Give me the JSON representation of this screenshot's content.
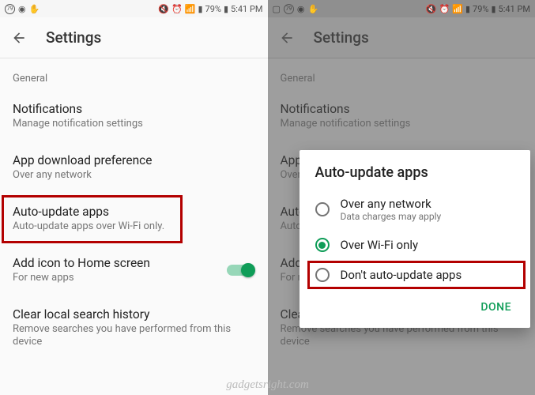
{
  "status": {
    "battery": "79%",
    "time": "5:41 PM",
    "num": "79"
  },
  "appbar": {
    "title": "Settings"
  },
  "section": {
    "general": "General"
  },
  "items": {
    "notifications": {
      "title": "Notifications",
      "sub": "Manage notification settings"
    },
    "download": {
      "title": "App download preference",
      "sub": "Over any network"
    },
    "autoupdate": {
      "title": "Auto-update apps",
      "sub": "Auto-update apps over Wi-Fi only."
    },
    "addicon": {
      "title": "Add icon to Home screen",
      "sub": "For new apps"
    },
    "clear": {
      "title": "Clear local search history",
      "sub": "Remove searches you have performed from this device"
    }
  },
  "itemsRight": {
    "download": {
      "title": "App d",
      "sub": "Over"
    },
    "autoupdate": {
      "title": "Auto-",
      "sub": "Auto-"
    },
    "addicon": {
      "title": "Add i",
      "sub": "For ne"
    },
    "clear": {
      "title": "Clear"
    }
  },
  "dialog": {
    "title": "Auto-update apps",
    "opt1": {
      "label": "Over any network",
      "sub": "Data charges may apply"
    },
    "opt2": {
      "label": "Over Wi-Fi only"
    },
    "opt3": {
      "label": "Don't auto-update apps"
    },
    "done": "DONE"
  },
  "watermark": "gadgetsright.com"
}
